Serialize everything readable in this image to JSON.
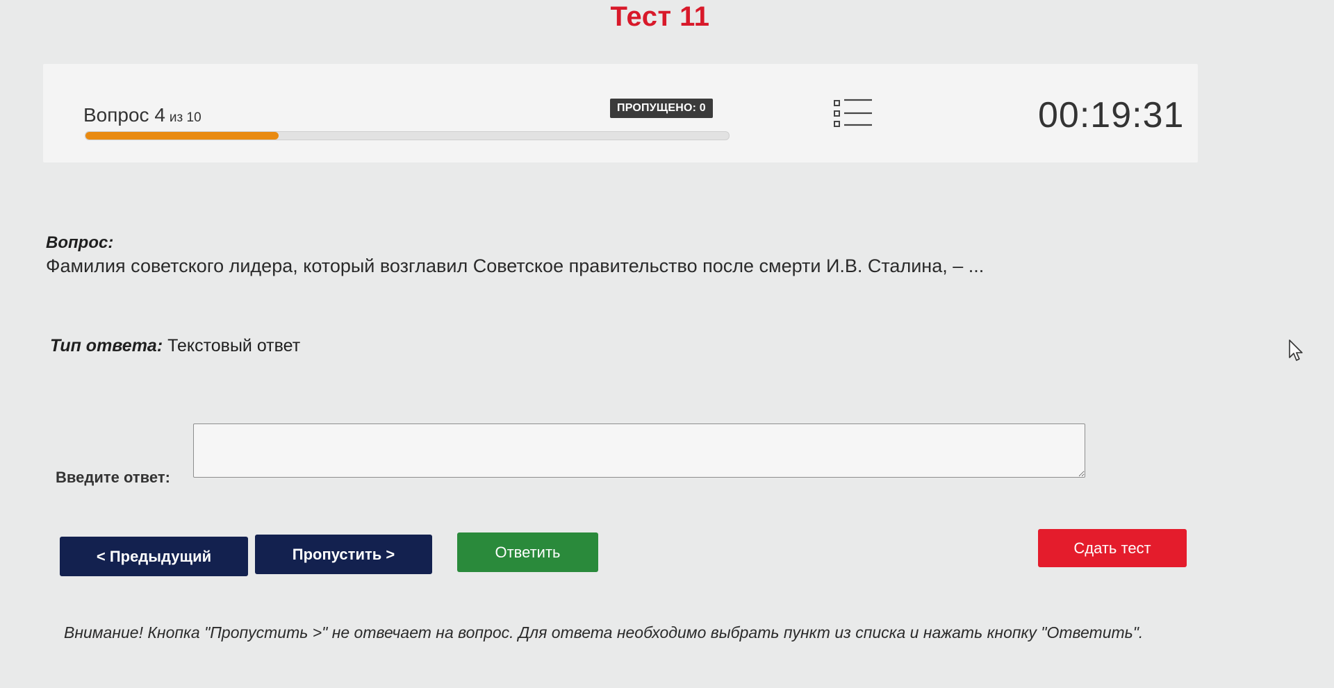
{
  "page": {
    "title": "Тест 11"
  },
  "status": {
    "question_label": "Вопрос 4",
    "of_total": "из 10",
    "current": 4,
    "total": 10,
    "progress_fraction": 0.3,
    "skipped_label": "ПРОПУЩЕНО: 0",
    "timer": "00:19:31"
  },
  "question": {
    "heading": "Вопрос:",
    "text": "Фамилия советского лидера, который возглавил Советское правительство после смерти И.В. Сталина, – ..."
  },
  "answer_type": {
    "label": "Тип ответа:",
    "value": "Текстовый ответ"
  },
  "answer": {
    "label": "Введите ответ:",
    "value": ""
  },
  "buttons": {
    "prev": "< Предыдущий",
    "skip": "Пропустить >",
    "answer": "Ответить",
    "submit": "Сдать тест"
  },
  "note": "Внимание! Кнопка \"Пропустить >\" не отвечает на вопрос. Для ответа необходимо выбрать пункт из списка и нажать кнопку \"Ответить\".",
  "icons": {
    "question_list": "question-list-icon",
    "cursor": "mouse-cursor-icon"
  },
  "colors": {
    "title": "#d8192a",
    "progress": "#e98a11",
    "nav_button": "#13214f",
    "answer_button": "#2a8a3b",
    "submit_button": "#e41c2c"
  }
}
